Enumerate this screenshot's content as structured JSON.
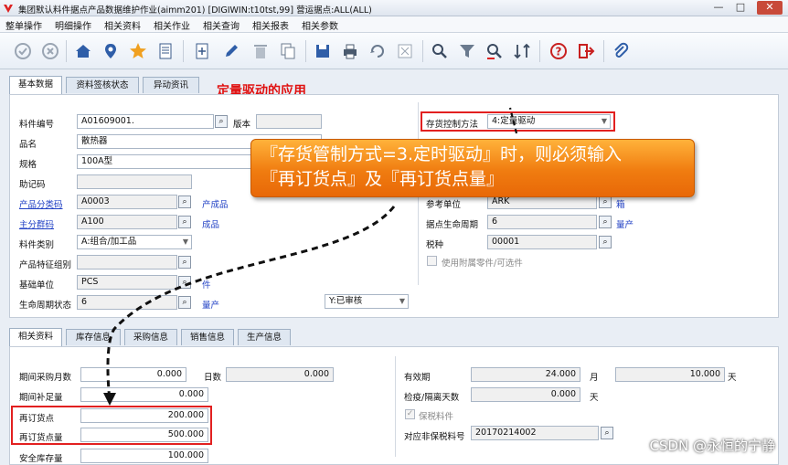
{
  "window": {
    "title": "集团默认料件据点产品数据维护作业(aimm201)    [DIGIWIN:t10tst,99]    营运据点:ALL(ALL)",
    "min": "—",
    "max": "□",
    "close": "✕"
  },
  "menu": [
    "整单操作",
    "明细操作",
    "相关资料",
    "相关作业",
    "相关查询",
    "相关报表",
    "相关参数"
  ],
  "toolbar_icons": [
    "check-icon",
    "cancel-icon",
    "home-icon",
    "location-icon",
    "star-icon",
    "list-icon",
    "add-icon",
    "edit-icon",
    "delete-icon",
    "copy-icon",
    "save-icon",
    "print-icon",
    "export-icon",
    "attach-export-icon",
    "search-icon",
    "filter-icon",
    "query-icon",
    "sort-icon",
    "help-icon",
    "exit-icon",
    "clip-icon"
  ],
  "colors": {
    "accent_red": "#e22020",
    "callout_orange": "#f07c10",
    "link_blue": "#1f3fc4"
  },
  "heading": "定量驱动的应用",
  "callout": {
    "line1": "『存货管制方式=3.定时驱动』时，则必须输入",
    "line2": "『再订货点』及『再订货点量』"
  },
  "top_tabs": [
    "基本数据",
    "资料签核状态",
    "异动资讯"
  ],
  "basic": {
    "item_no_label": "料件编号",
    "item_no": "A01609001.",
    "version_label": "版本",
    "name_label": "品名",
    "name": "散热器",
    "spec_label": "规格",
    "spec": "100A型",
    "mnemonic_label": "助记码",
    "prod_cat_label": "产品分类码",
    "prod_cat": "A0003",
    "prod_cat_desc": "产成品",
    "main_group_label": "主分群码",
    "main_group": "A100",
    "main_group_desc": "成品",
    "item_type_label": "料件类别",
    "item_type": "A:组合/加工品",
    "feature_label": "产品特征组别",
    "base_unit_label": "基础单位",
    "base_unit": "PCS",
    "base_unit_desc": "件",
    "lifecycle_label": "生命周期状态",
    "lifecycle": "6",
    "lifecycle_desc": "量产",
    "status": "Y:已审核"
  },
  "right": {
    "inv_ctrl_label": "存货控制方法",
    "inv_ctrl": "4:定量驱动",
    "ref_unit_label": "参考单位",
    "ref_unit": "ARK",
    "ref_unit_desc": "箱",
    "site_life_label": "据点生命周期",
    "site_life": "6",
    "site_life_desc": "量产",
    "tax_label": "税种",
    "tax": "00001",
    "use_attach_label": "使用附属零件/可选件"
  },
  "bottom_tabs": [
    "相关资料",
    "库存信息",
    "采购信息",
    "销售信息",
    "生产信息"
  ],
  "related": {
    "period_purchase_label": "期间采购月数",
    "period_purchase": "0.000",
    "days_label": "日数",
    "days": "0.000",
    "period_supply_label": "期间补足量",
    "period_supply": "0.000",
    "reorder_point_label": "再订货点",
    "reorder_point": "200.000",
    "reorder_qty_label": "再订货点量",
    "reorder_qty": "500.000",
    "safety_stock_label": "安全库存量",
    "safety_stock": "100.000",
    "valid_label": "有效期",
    "valid_value": "24.000",
    "month_unit": "月",
    "valid_days": "10.000",
    "day_unit": "天",
    "quarantine_label": "检疫/隔离天数",
    "quarantine": "0.000",
    "quarantine_unit": "天",
    "bonded_label": "保税料件",
    "bonded_no_label": "对应非保税料号",
    "bonded_no": "20170214002"
  },
  "watermark": "CSDN @永恒的宁静"
}
